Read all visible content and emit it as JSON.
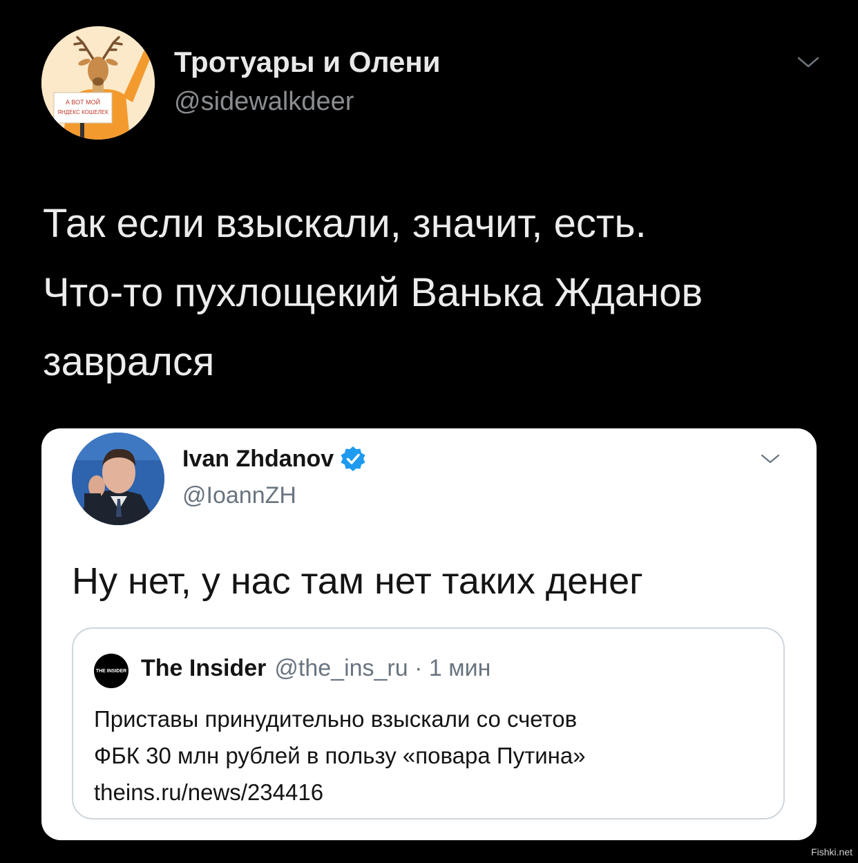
{
  "tweet": {
    "author_name": "Тротуары и Олени",
    "author_handle": "@sidewalkdeer",
    "avatar_sign_text": "А ВОТ МОЙ ЯНДЕКС КОШЕЛЕК",
    "text_lines": [
      "Так если взыскали, значит, есть.",
      "Что-то пухлощекий Ванька Жданов",
      "заврался"
    ],
    "menu_icon": "chevron-down-icon"
  },
  "embedded": {
    "author_name": "Ivan Zhdanov",
    "author_handle": "@IoannZH",
    "verified_icon": "verified-badge-icon",
    "menu_icon": "chevron-down-icon",
    "text": "Ну нет, у нас там нет таких денег",
    "quote": {
      "logo_text": "THE INSIDER",
      "name": "The Insider",
      "meta": "@the_ins_ru · 1 мин",
      "body_lines": [
        "Приставы принудительно взыскали со счетов",
        "ФБК 30 млн рублей в пользу «повара Путина»",
        "theins.ru/news/234416"
      ]
    }
  },
  "watermark": "Fishki.net",
  "colors": {
    "background": "#000000",
    "verified": "#1d9bf0",
    "card": "#ffffff"
  }
}
